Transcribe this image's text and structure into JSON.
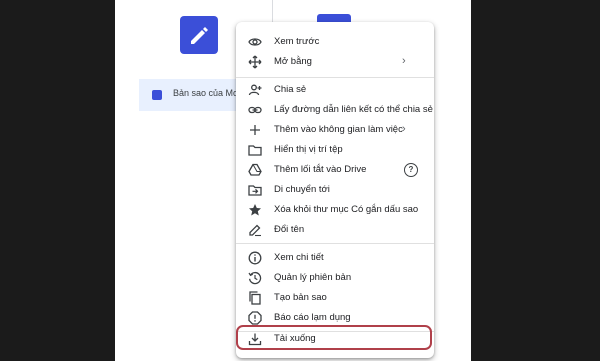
{
  "background_file": {
    "name": "Bản sao của Moji"
  },
  "menu": {
    "items": [
      {
        "label": "Xem trước",
        "icon": "eye-icon"
      },
      {
        "label": "Mở bằng",
        "icon": "move-icon",
        "submenu": true
      },
      {
        "label": "Chia sẻ",
        "icon": "person-add-icon"
      },
      {
        "label": "Lấy đường dẫn liên kết có thể chia sẻ",
        "icon": "link-icon"
      },
      {
        "label": "Thêm vào không gian làm việc",
        "icon": "plus-icon",
        "submenu": true
      },
      {
        "label": "Hiển thị vị trí tệp",
        "icon": "folder-icon"
      },
      {
        "label": "Thêm lối tắt vào Drive",
        "icon": "drive-shortcut-icon",
        "help": "?"
      },
      {
        "label": "Di chuyển tới",
        "icon": "move-to-folder-icon"
      },
      {
        "label": "Xóa khỏi thư mục Có gắn dấu sao",
        "icon": "star-icon"
      },
      {
        "label": "Đổi tên",
        "icon": "pencil-icon"
      },
      {
        "label": "Xem chi tiết",
        "icon": "info-icon"
      },
      {
        "label": "Quản lý phiên bản",
        "icon": "history-icon"
      },
      {
        "label": "Tạo bản sao",
        "icon": "copy-icon"
      },
      {
        "label": "Báo cáo lạm dụng",
        "icon": "report-icon"
      },
      {
        "label": "Tải xuống",
        "icon": "download-icon",
        "highlighted": true
      }
    ],
    "chevron": "›"
  },
  "colors": {
    "accent_blue": "#3b4fd8",
    "highlight_border": "#b0404a",
    "selected_row": "#e8f0fe"
  }
}
